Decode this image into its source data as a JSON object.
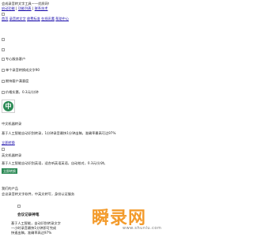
{
  "header": {
    "tagline": "会成录音转文字工具——优质网！",
    "links": [
      "启动功能",
      "功能列表",
      "联系技术"
    ]
  },
  "nav": {
    "items": [
      "首页",
      "录音转文字",
      "收费标准",
      "在线讯鹰",
      "帮助中心"
    ]
  },
  "features": {
    "items": [
      "专心服务客户",
      "单个录音转换成文字90",
      "期待客户满意度",
      "价格实惠，0.3元/分钟"
    ]
  },
  "badge": {
    "glyph": "中"
  },
  "product_1": {
    "title": "中文机器转录",
    "description": "基于人工智能自动识别转录，1分钟录音最快1分钟出稿，准确率最高可达97%",
    "link": "立即转换"
  },
  "product_2": {
    "title": "英文机器转录",
    "description": "基于人工智能自动识别英语，适合听英语英语，自动校对，0.3元/分钟。",
    "button": "立即转换"
  },
  "products_section": {
    "heading": "我们的产品",
    "subheading": "会议录音转文字软件，中英文转写，身份认证服务"
  },
  "hero": {
    "title": "会议记录神笔",
    "bullets": [
      "基于人工智能，自动识别转录文字",
      "一小时录音最快1分钟即可完成",
      "快速出稿，准确率高达97%"
    ]
  },
  "watermark": {
    "text": "瞬录网",
    "sub": "www.shunlu.com"
  }
}
